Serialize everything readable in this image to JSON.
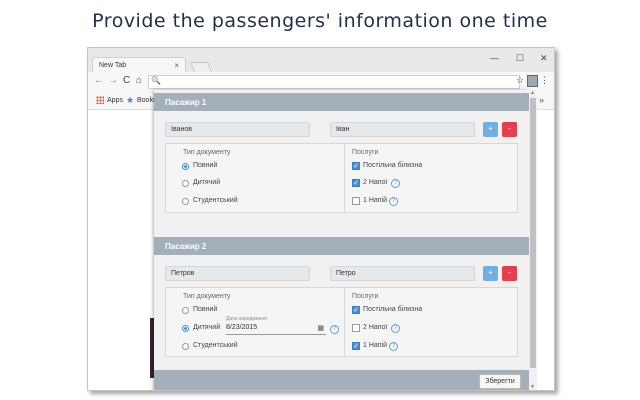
{
  "caption": "Provide the passengers' information one time",
  "browser": {
    "tab_title": "New Tab",
    "tab_close": "×",
    "win_min": "—",
    "win_max": "☐",
    "win_close": "✕",
    "back": "←",
    "forward": "→",
    "reload": "C",
    "home": "⌂",
    "search_glyph": "🔍",
    "url": "",
    "bookmark_star": "☆",
    "menu": "⋮",
    "bookmarks": {
      "apps": "Apps",
      "bookmarks": "Bookm",
      "overflow": "»"
    }
  },
  "form": {
    "passengers": [
      {
        "header": "Пасажир 1",
        "last_name": "Іванов",
        "first_name": "Іван",
        "doc_label": "Тип документу",
        "services_label": "Послуги",
        "doc_options": [
          "Повний",
          "Дитячий",
          "Студентський"
        ],
        "selected_doc": 0,
        "services": [
          {
            "label": "Постільна білизна",
            "checked": true
          },
          {
            "label": "2 Напої",
            "checked": true
          },
          {
            "label": "1 Напій",
            "checked": false
          }
        ]
      },
      {
        "header": "Пасажир 2",
        "last_name": "Петров",
        "first_name": "Петро",
        "doc_label": "Тип документу",
        "services_label": "Послуги",
        "doc_options": [
          "Повний",
          "Дитячий",
          "Студентський"
        ],
        "selected_doc": 1,
        "birth_date_label": "Дата народження",
        "birth_date": "8/23/2015",
        "services": [
          {
            "label": "Постільна білизна",
            "checked": true
          },
          {
            "label": "2 Напої",
            "checked": false
          },
          {
            "label": "1 Напій",
            "checked": true
          }
        ]
      }
    ],
    "add_label": "+",
    "remove_label": "-",
    "help_glyph": "?",
    "check_glyph": "✓",
    "save_label": "Зберегти",
    "accent_colors": {
      "add": "#70aee3",
      "remove": "#e53e4f",
      "header": "#a3b0ba"
    }
  }
}
